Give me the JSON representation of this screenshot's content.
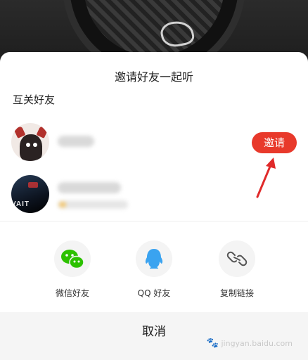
{
  "sheet": {
    "title": "邀请好友一起听",
    "section_label": "互关好友"
  },
  "friends": [
    {
      "avatar": "moose-avatar",
      "invite_label": "邀请"
    },
    {
      "avatar": "night-street-avatar"
    }
  ],
  "share": [
    {
      "label": "微信好友",
      "icon": "wechat-icon"
    },
    {
      "label": "QQ 好友",
      "icon": "qq-icon"
    },
    {
      "label": "复制链接",
      "icon": "link-icon"
    }
  ],
  "cancel_label": "取消",
  "avatar2_sign_text": "VAIT",
  "watermark": "jingyan.baidu.com",
  "colors": {
    "accent_red": "#e8392b",
    "wechat_green": "#2dc100",
    "qq_blue": "#3aa3f0"
  }
}
